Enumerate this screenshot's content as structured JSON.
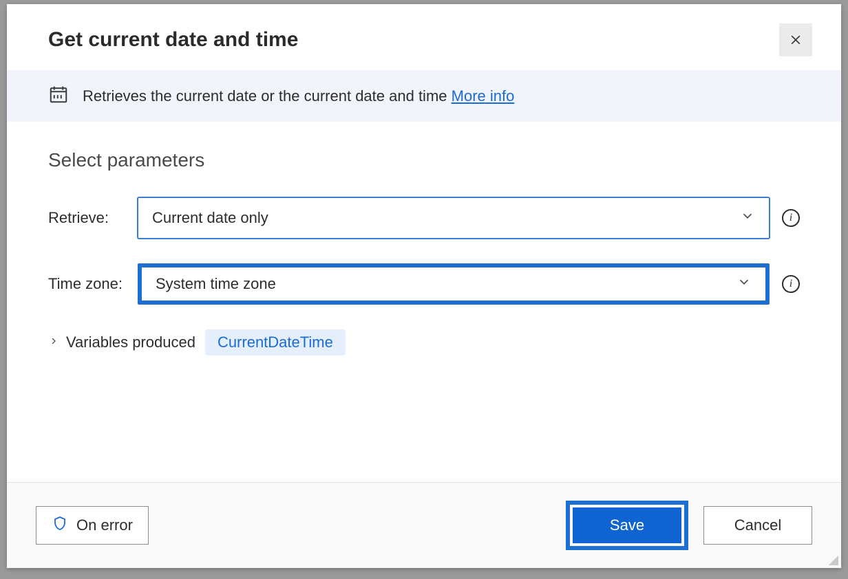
{
  "dialog": {
    "title": "Get current date and time",
    "description": "Retrieves the current date or the current date and time",
    "more_info_label": "More info"
  },
  "section": {
    "title": "Select parameters"
  },
  "params": {
    "retrieve_label": "Retrieve:",
    "retrieve_value": "Current date only",
    "timezone_label": "Time zone:",
    "timezone_value": "System time zone"
  },
  "variables": {
    "toggle_label": "Variables produced",
    "chip": "CurrentDateTime"
  },
  "footer": {
    "on_error_label": "On error",
    "save_label": "Save",
    "cancel_label": "Cancel"
  }
}
